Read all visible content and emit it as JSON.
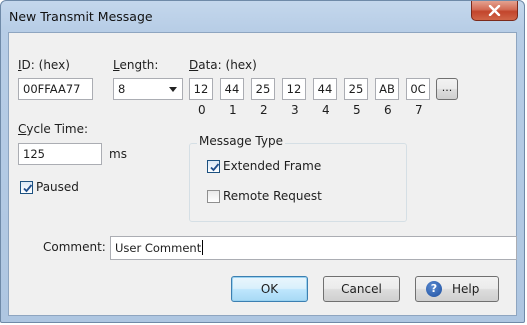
{
  "window": {
    "title": "New Transmit Message"
  },
  "id": {
    "label_ul": "I",
    "label_rest": "D: (hex)",
    "value": "00FFAA77"
  },
  "length": {
    "label_ul": "L",
    "label_rest": "ength:",
    "value": "8"
  },
  "data": {
    "label_ul": "D",
    "label_rest": "ata: (hex)",
    "bytes": [
      "12",
      "44",
      "25",
      "12",
      "44",
      "25",
      "AB",
      "0C"
    ],
    "indices": [
      "0",
      "1",
      "2",
      "3",
      "4",
      "5",
      "6",
      "7"
    ],
    "more_label": "..."
  },
  "cycle_time": {
    "label_ul": "C",
    "label_rest": "ycle Time:",
    "value": "125",
    "unit": "ms"
  },
  "paused": {
    "label": "Paused",
    "checked": true
  },
  "message_type": {
    "title": "Message Type",
    "extended_frame": {
      "label": "Extended Frame",
      "checked": true
    },
    "remote_request": {
      "label": "Remote Request",
      "checked": false
    }
  },
  "comment": {
    "label": "Comment:",
    "value": "User Comment"
  },
  "buttons": {
    "ok": "OK",
    "cancel": "Cancel",
    "help": "Help"
  },
  "icons": {
    "close": "close-icon",
    "help": "help-icon",
    "check": "checkmark-icon",
    "dropdown": "chevron-down-icon"
  }
}
